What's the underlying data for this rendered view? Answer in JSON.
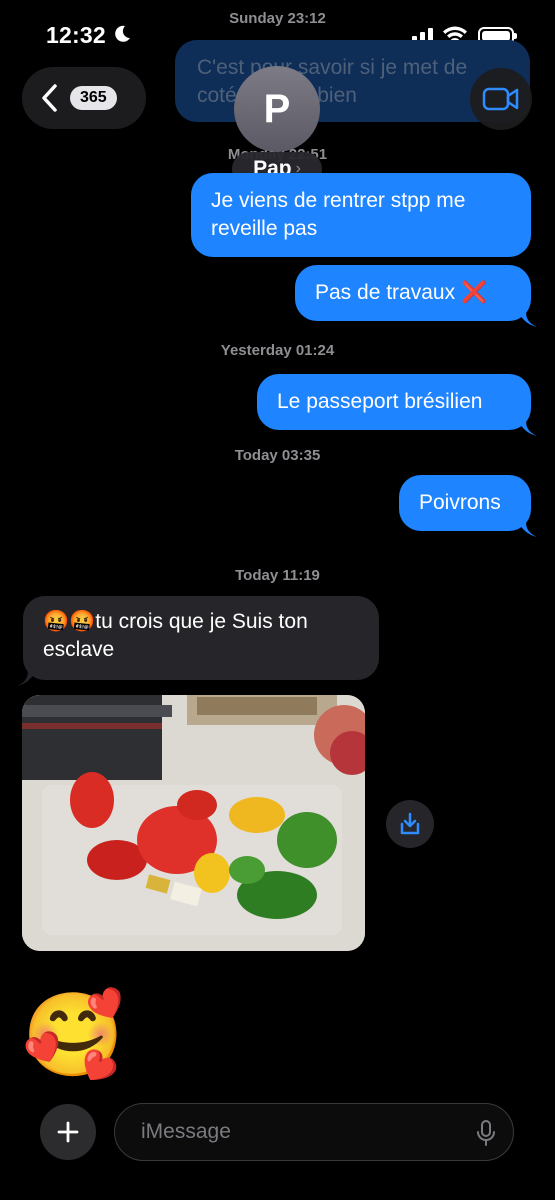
{
  "status_bar": {
    "time": "12:32"
  },
  "header": {
    "unread_count": "365",
    "avatar_initial": "P",
    "contact_name": "Pap",
    "contact_chevron": "›"
  },
  "messages": {
    "ts_sunday": "Sunday 23:12",
    "faded_msg": "C'est pour savoir si je met de coté chez Fabien",
    "ts_monday": "Monday 22:51",
    "msg1": "Je viens de rentrer stpp me reveille pas",
    "msg2_text": "Pas de travaux",
    "msg2_emoji": "❌",
    "ts_yesterday": "Yesterday 01:24",
    "msg3": "Le passeport brésilien",
    "ts_today1": "Today 03:35",
    "msg4": "Poivrons",
    "ts_today2": "Today 11:19",
    "recv_emoji": "🤬🤬",
    "recv_msg": "tu crois que je Suis ton esclave",
    "sticker_emoji": "🥰"
  },
  "composer": {
    "placeholder": "iMessage"
  },
  "colors": {
    "sent_bubble": "#1f84ff",
    "received_bubble": "#26262a",
    "background": "#000000"
  },
  "icons": [
    "back-chevron-icon",
    "video-camera-icon",
    "save-download-icon",
    "plus-icon",
    "microphone-icon",
    "signal-icon",
    "wifi-icon",
    "battery-icon",
    "moon-icon"
  ]
}
